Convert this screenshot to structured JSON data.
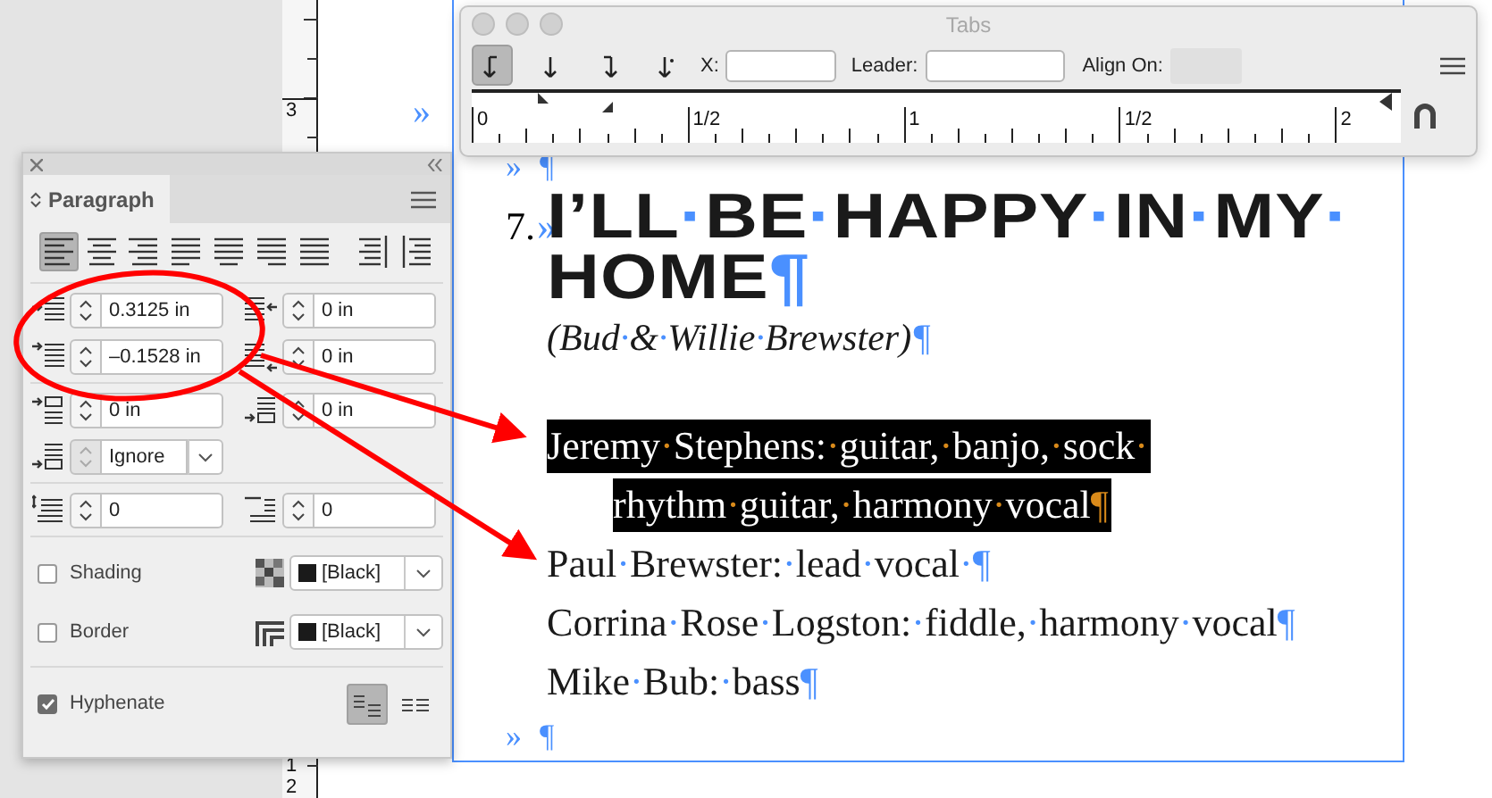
{
  "vertical_ruler": {
    "labels": [
      "3",
      "1",
      "2"
    ]
  },
  "document": {
    "margin_marker": "»",
    "top_marker": {
      "arrow": "»",
      "pilcrow": "¶"
    },
    "title": {
      "number": "7.",
      "arrow": "»",
      "lines": [
        "I’LL·BE·HAPPY·IN·MY·",
        "HOME¶"
      ]
    },
    "subtitle": "(Bud·&·Willie·Brewster)¶",
    "credits": [
      {
        "lines": [
          "Jeremy·Stephens:·guitar,·banjo,·sock·",
          "rhythm·guitar,·harmony·vocal¶"
        ],
        "selected": true
      },
      {
        "lines": [
          "Paul·Brewster:·lead·vocal·¶"
        ],
        "selected": false
      },
      {
        "lines": [
          "Corrina·Rose·Logston:·fiddle,·harmony·vocal¶"
        ],
        "selected": false
      },
      {
        "lines": [
          "Mike·Bub:·bass¶"
        ],
        "selected": false
      }
    ],
    "bottom_marker": {
      "arrow": "»",
      "pilcrow": "¶"
    }
  },
  "tabs_panel": {
    "title": "Tabs",
    "tab_buttons": [
      {
        "kind": "left",
        "selected": true
      },
      {
        "kind": "center",
        "selected": false
      },
      {
        "kind": "right",
        "selected": false
      },
      {
        "kind": "decimal",
        "selected": false
      }
    ],
    "x_label": "X:",
    "leader_label": "Leader:",
    "align_on_label": "Align On:",
    "ruler_labels": [
      "0",
      "1/2",
      "1",
      "1/2",
      "2"
    ]
  },
  "paragraph_panel": {
    "tab": "Paragraph",
    "alignment_buttons": [
      {
        "kind": "left",
        "selected": true
      },
      {
        "kind": "center",
        "selected": false
      },
      {
        "kind": "right",
        "selected": false
      },
      {
        "kind": "justify-left",
        "selected": false
      },
      {
        "kind": "justify-center",
        "selected": false
      },
      {
        "kind": "justify-right",
        "selected": false
      },
      {
        "kind": "justify-all",
        "selected": false
      },
      {
        "kind": "toward-spine",
        "selected": false
      },
      {
        "kind": "away-spine",
        "selected": false
      }
    ],
    "field_rows": [
      [
        {
          "kind": "left-indent",
          "value": "0.3125 in"
        },
        {
          "kind": "right-indent",
          "value": "0 in"
        }
      ],
      [
        {
          "kind": "first-line-indent",
          "value": "–0.1528 in"
        },
        {
          "kind": "last-line-indent",
          "value": "0 in"
        }
      ],
      [
        {
          "kind": "space-before",
          "value": "0 in"
        },
        {
          "kind": "space-after",
          "value": "0 in"
        }
      ],
      [
        {
          "kind": "grid-align",
          "value": "Ignore"
        }
      ],
      [
        {
          "kind": "drop-cap-lines",
          "value": "0"
        },
        {
          "kind": "drop-cap-chars",
          "value": "0"
        }
      ]
    ],
    "shading": {
      "label": "Shading",
      "checked": false,
      "swatch": "[Black]"
    },
    "border": {
      "label": "Border",
      "checked": false,
      "swatch": "[Black]"
    },
    "hyphenate": {
      "label": "Hyphenate",
      "checked": true
    },
    "composer_buttons": [
      {
        "kind": "single-line",
        "selected": true
      },
      {
        "kind": "paragraph",
        "selected": false
      }
    ]
  }
}
